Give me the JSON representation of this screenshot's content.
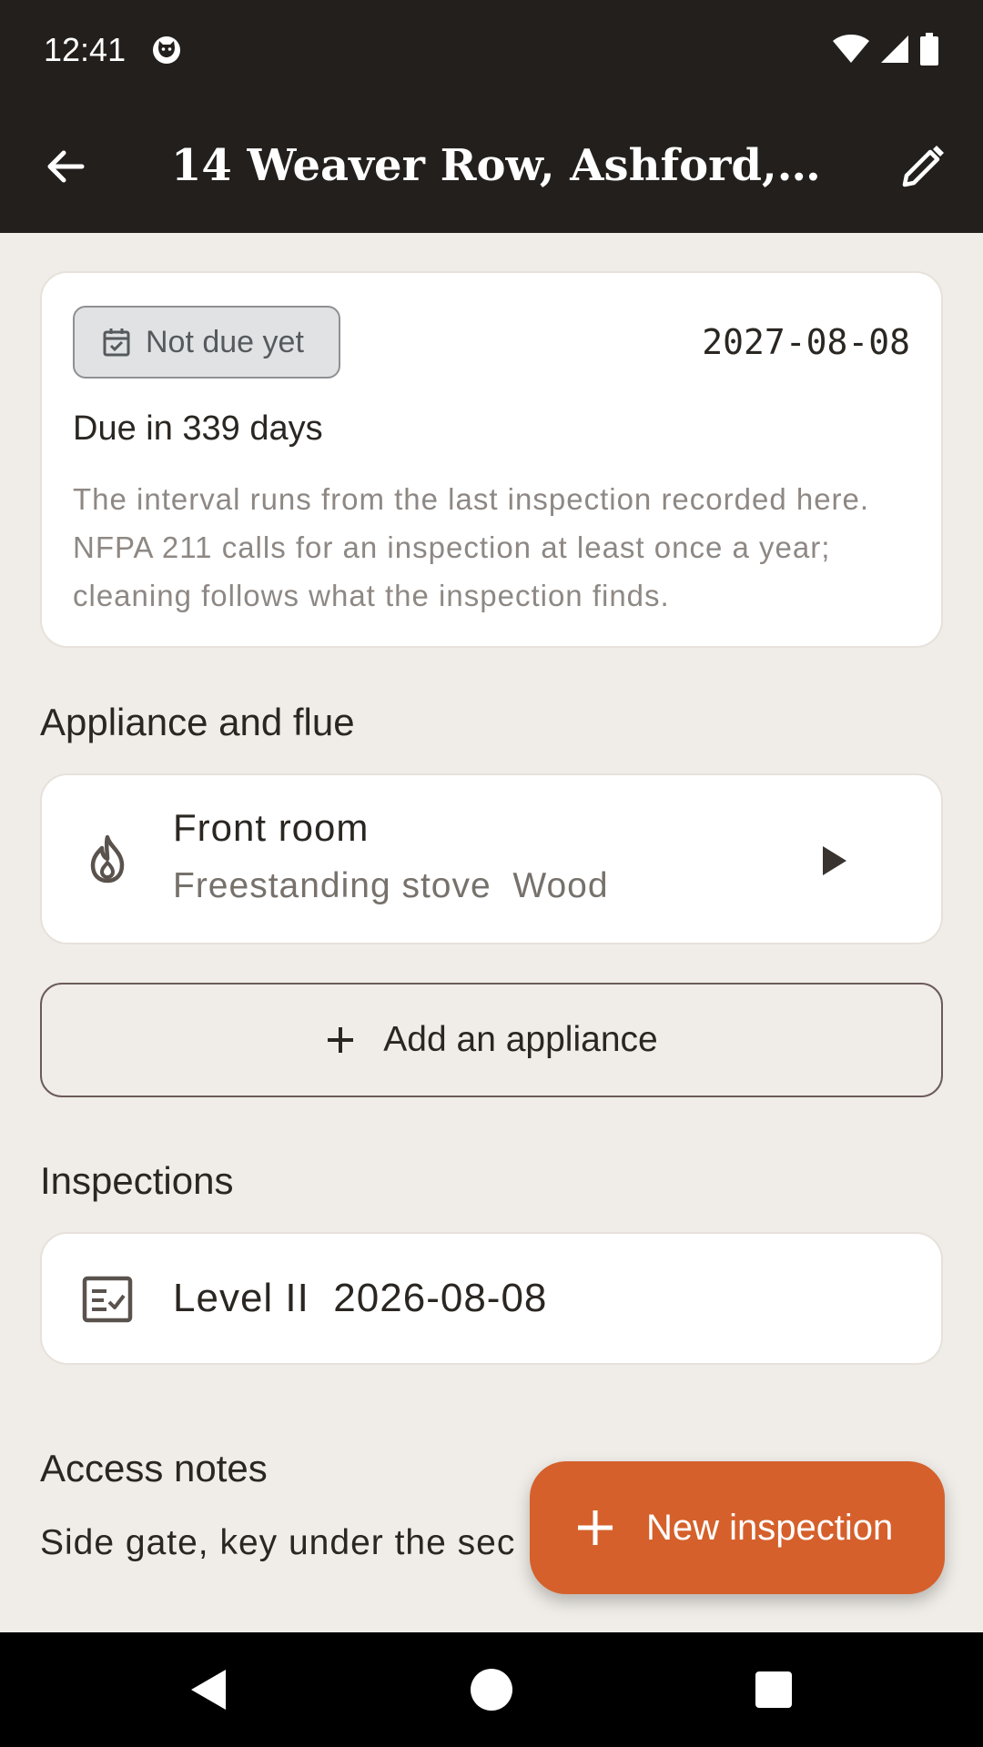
{
  "status_bar": {
    "time": "12:41",
    "icons": [
      "cat-notification-icon",
      "wifi-icon",
      "signal-icon",
      "battery-icon"
    ]
  },
  "app_bar": {
    "title": "14 Weaver Row, Ashford, T...",
    "back_icon": "arrow-back-icon",
    "edit_icon": "pencil-edit-icon"
  },
  "due_card": {
    "status_label": "Not due yet",
    "status_icon": "calendar-check-icon",
    "due_date": "2027-08-08",
    "due_in": "Due in 339 days",
    "note": "The interval runs from the last inspection recorded here. NFPA 211 calls for an inspection at least once a year; cleaning follows what the inspection finds."
  },
  "appliance_section": {
    "heading": "Appliance and flue",
    "items": [
      {
        "icon": "flame-icon",
        "title": "Front room",
        "subtitle": "Freestanding stove  Wood"
      }
    ],
    "add_label": "Add an appliance"
  },
  "inspections_section": {
    "heading": "Inspections",
    "items": [
      {
        "icon": "checklist-icon",
        "label": "Level II  2026-08-08"
      }
    ]
  },
  "access_notes": {
    "heading": "Access notes",
    "text": "Side gate, key under the sec"
  },
  "fab": {
    "label": "New inspection",
    "icon": "plus-icon"
  },
  "colors": {
    "app_bar": "#231f1c",
    "background": "#f0ede8",
    "accent": "#d5602b"
  }
}
